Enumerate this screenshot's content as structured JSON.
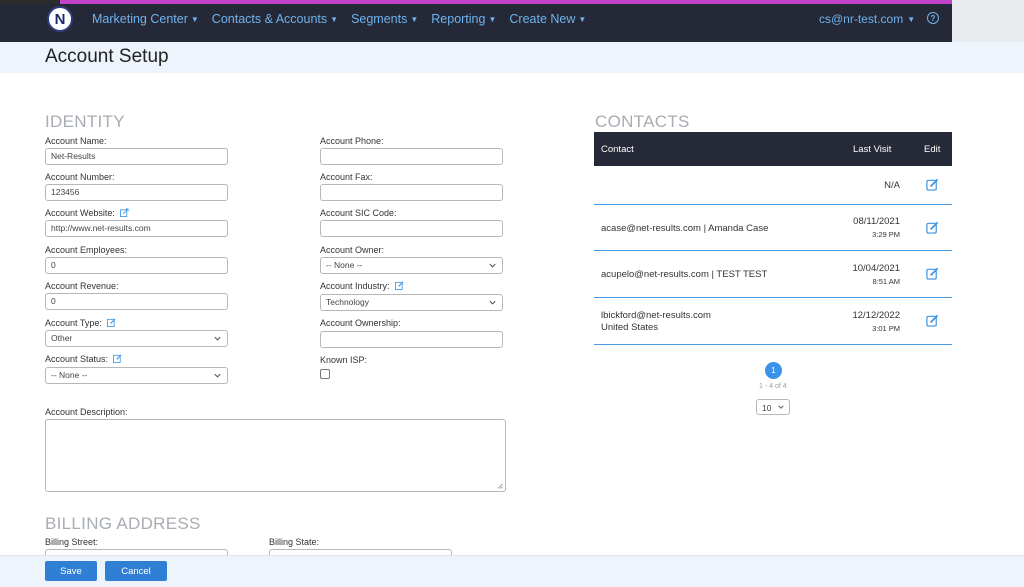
{
  "nav": {
    "logo_letter": "N",
    "items": [
      {
        "label": "Marketing Center"
      },
      {
        "label": "Contacts & Accounts"
      },
      {
        "label": "Segments"
      },
      {
        "label": "Reporting"
      },
      {
        "label": "Create New"
      }
    ],
    "user": "cs@nr-test.com",
    "help": "?"
  },
  "page": {
    "title": "Account Setup"
  },
  "identity": {
    "heading": "IDENTITY",
    "account_name": {
      "label": "Account Name:",
      "value": "Net-Results"
    },
    "account_number": {
      "label": "Account Number:",
      "value": "123456"
    },
    "account_website": {
      "label": "Account Website:",
      "value": "http://www.net-results.com"
    },
    "account_employees": {
      "label": "Account Employees:",
      "value": "0"
    },
    "account_revenue": {
      "label": "Account Revenue:",
      "value": "0"
    },
    "account_type": {
      "label": "Account Type:",
      "value": "Other"
    },
    "account_status": {
      "label": "Account Status:",
      "value": "-- None --"
    },
    "account_phone": {
      "label": "Account Phone:",
      "value": ""
    },
    "account_fax": {
      "label": "Account Fax:",
      "value": ""
    },
    "account_sic": {
      "label": "Account SIC Code:",
      "value": ""
    },
    "account_owner": {
      "label": "Account Owner:",
      "value": "-- None --"
    },
    "account_industry": {
      "label": "Account Industry:",
      "value": "Technology"
    },
    "account_ownership": {
      "label": "Account Ownership:",
      "value": ""
    },
    "known_isp": {
      "label": "Known ISP:",
      "checked": false
    },
    "account_description": {
      "label": "Account Description:",
      "value": ""
    }
  },
  "billing": {
    "heading": "BILLING ADDRESS",
    "street_label": "Billing Street:",
    "state_label": "Billing State:"
  },
  "contacts": {
    "heading": "CONTACTS",
    "columns": {
      "contact": "Contact",
      "last_visit": "Last Visit",
      "edit": "Edit"
    },
    "rows": [
      {
        "contact": "",
        "contact2": "",
        "date": "",
        "time": "",
        "na": "N/A"
      },
      {
        "contact": "acase@net-results.com | Amanda Case",
        "contact2": "",
        "date": "08/11/2021",
        "time": "3:29 PM",
        "na": ""
      },
      {
        "contact": "acupelo@net-results.com | TEST TEST",
        "contact2": "",
        "date": "10/04/2021",
        "time": "8:51 AM",
        "na": ""
      },
      {
        "contact": "lbickford@net-results.com",
        "contact2": "United States",
        "date": "12/12/2022",
        "time": "3:01 PM",
        "na": ""
      }
    ],
    "pager": {
      "page": "1",
      "range": "1 - 4 of 4",
      "page_size": "10"
    }
  },
  "footer": {
    "save_label": "Save",
    "cancel_label": "Cancel"
  },
  "colors": {
    "accent": "#2f7fd4",
    "nav_bg": "#252836",
    "nav_link": "#6fb3ee",
    "row_divider": "#4a9be3"
  }
}
